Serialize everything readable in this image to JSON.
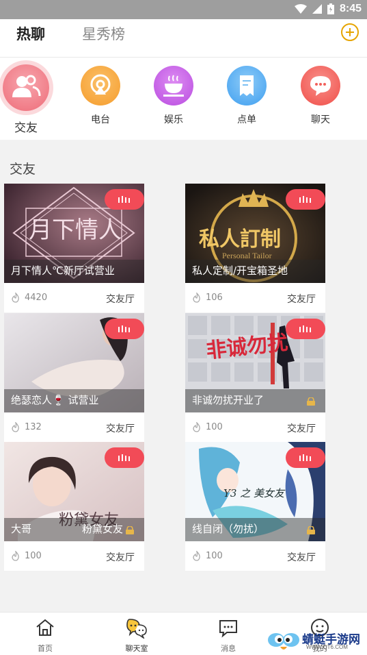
{
  "status_bar": {
    "time": "8:45"
  },
  "header": {
    "tabs": [
      {
        "label": "热聊",
        "active": true
      },
      {
        "label": "星秀榜",
        "active": false
      }
    ]
  },
  "categories": [
    {
      "label": "交友",
      "icon": "people-icon",
      "color": "#f26d7a"
    },
    {
      "label": "电台",
      "icon": "radio-icon",
      "color": "#f7a23b"
    },
    {
      "label": "娱乐",
      "icon": "cup-icon",
      "color": "#c45ce6"
    },
    {
      "label": "点单",
      "icon": "receipt-icon",
      "color": "#4aa8ef"
    },
    {
      "label": "聊天",
      "icon": "chat-bubble-icon",
      "color": "#f25a55"
    }
  ],
  "section": {
    "title": "交友"
  },
  "rooms": [
    {
      "title": "月下情人℃新厅试营业",
      "count": "4420",
      "type": "交友厅",
      "art_text": "月下情人",
      "locked": false
    },
    {
      "title": "私人定制/开宝箱圣地",
      "count": "106",
      "type": "交友厅",
      "art_text": "私人訂制",
      "art_sub": "Personal Tailor",
      "locked": false
    },
    {
      "title": "绝瑟恋人🍷 试营业",
      "count": "132",
      "type": "交友厅",
      "locked": false
    },
    {
      "title": "非诚勿扰开业了",
      "count": "100",
      "type": "交友厅",
      "art_text": "非诚勿扰",
      "locked": true
    },
    {
      "title": "大哥",
      "title2": "粉黛女友",
      "count": "100",
      "type": "交友厅",
      "art_text": "粉黛女友",
      "locked": true
    },
    {
      "title": "线自闭（勿扰）",
      "count": "100",
      "type": "交友厅",
      "art_text": "Y3 之 美女友",
      "locked": true
    }
  ],
  "bottom_nav": [
    {
      "label": "首页",
      "icon": "home-icon",
      "active": false
    },
    {
      "label": "聊天室",
      "icon": "chatroom-icon",
      "active": true
    },
    {
      "label": "消息",
      "icon": "message-icon",
      "active": false
    },
    {
      "label": "我的",
      "icon": "profile-icon",
      "active": false
    }
  ],
  "watermark": {
    "text": "蜻蜓手游网",
    "sub": "WWW.QT6.COM"
  },
  "colors": {
    "accent": "#f24b57",
    "gold": "#e6a400"
  }
}
